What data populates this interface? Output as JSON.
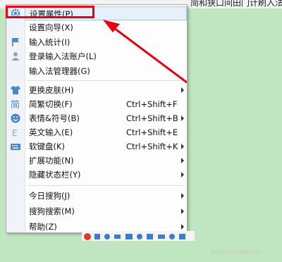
{
  "background": {
    "top_text": "简和狭口间田门计刷入法融到下…点击到输入法融合这首个拨子",
    "color": "#bfe5c1"
  },
  "menu": {
    "items": [
      {
        "label": "设置属性(P)",
        "shortcut": "",
        "submenu": false,
        "icon": "gear-icon",
        "highlighted": true
      },
      {
        "label": "设置向导(X)",
        "shortcut": "",
        "submenu": false,
        "icon": "",
        "highlighted": false
      },
      {
        "label": "输入统计(I)",
        "shortcut": "",
        "submenu": false,
        "icon": "flag-icon",
        "highlighted": false
      },
      {
        "label": "登录输入法账户(L)",
        "shortcut": "",
        "submenu": false,
        "icon": "user-icon",
        "highlighted": false
      },
      {
        "label": "输入法管理器(G)",
        "shortcut": "",
        "submenu": false,
        "icon": "",
        "highlighted": false
      },
      {
        "label": "更换皮肤(H)",
        "shortcut": "",
        "submenu": true,
        "icon": "shirt-icon",
        "highlighted": false
      },
      {
        "label": "简繁切换(F)",
        "shortcut": "Ctrl+Shift+F",
        "submenu": false,
        "icon": "simplified-char-icon",
        "highlighted": false
      },
      {
        "label": "表情&符号(B)",
        "shortcut": "Ctrl+Shift+B",
        "submenu": true,
        "icon": "smiley-icon",
        "highlighted": false
      },
      {
        "label": "英文输入(E)",
        "shortcut": "Ctrl+Shift+E",
        "submenu": false,
        "icon": "english-e-icon",
        "highlighted": false
      },
      {
        "label": "软键盘(K)",
        "shortcut": "Ctrl+Shift+K",
        "submenu": true,
        "icon": "keyboard-icon",
        "highlighted": false
      },
      {
        "label": "扩展功能(N)",
        "shortcut": "",
        "submenu": true,
        "icon": "",
        "highlighted": false
      },
      {
        "label": "隐藏状态栏(Y)",
        "shortcut": "",
        "submenu": true,
        "icon": "",
        "highlighted": false
      },
      {
        "label": "今日搜狗(J)",
        "shortcut": "",
        "submenu": true,
        "icon": "",
        "highlighted": false
      },
      {
        "label": "搜狗搜索(M)",
        "shortcut": "",
        "submenu": true,
        "icon": "",
        "highlighted": false
      },
      {
        "label": "帮助(Z)",
        "shortcut": "",
        "submenu": true,
        "icon": "",
        "highlighted": false
      }
    ],
    "colors": {
      "highlight_bg": "#e6f0fb",
      "icon_blue": "#4a86c8",
      "annotation_red": "#e60012"
    }
  },
  "watermark": "jingyan.baidu.com"
}
